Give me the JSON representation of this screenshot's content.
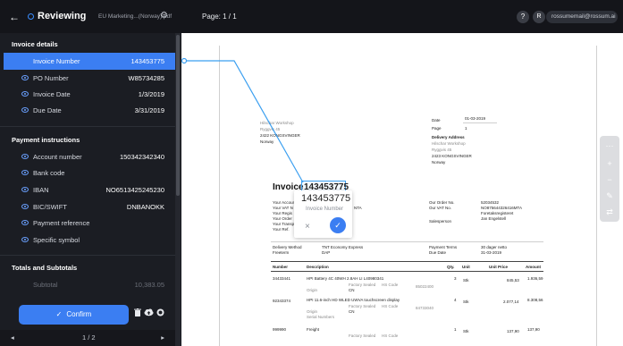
{
  "topbar": {
    "back_glyph": "←",
    "status": "Reviewing",
    "filename": "EU Marketing...(Norway).pdf",
    "gear_glyph": "⚙",
    "page": "Page: 1 / 1",
    "help": "?",
    "avatar": "R",
    "user_email": "rossumemail@rossum.ai"
  },
  "sidebar": {
    "invoice_details": {
      "title": "Invoice details",
      "rows": [
        {
          "label": "Invoice Number",
          "value": "143453775"
        },
        {
          "label": "PO Number",
          "value": "W85734285"
        },
        {
          "label": "Invoice Date",
          "value": "1/3/2019"
        },
        {
          "label": "Due Date",
          "value": "3/31/2019"
        }
      ]
    },
    "payment": {
      "title": "Payment instructions",
      "rows": [
        {
          "label": "Account number",
          "value": "150342342340"
        },
        {
          "label": "Bank code",
          "value": ""
        },
        {
          "label": "IBAN",
          "value": "NO6513425245230"
        },
        {
          "label": "BIC/SWIFT",
          "value": "DNBANOKK"
        },
        {
          "label": "Payment reference",
          "value": ""
        },
        {
          "label": "Specific symbol",
          "value": ""
        }
      ]
    },
    "totals": {
      "title": "Totals and Subtotals",
      "rows": [
        {
          "label": "Subtotal",
          "value": "10,383.05"
        }
      ]
    },
    "footer": {
      "confirm": "Confirm",
      "check_glyph": "✓",
      "pager": {
        "prev": "◂",
        "label": "1 / 2",
        "next": "▸"
      },
      "icons": [
        "trash-icon",
        "cloud-upload-icon",
        "block-icon"
      ]
    }
  },
  "document": {
    "from_name": "Hilschar Workshop",
    "from_street": "Ryggvis 45",
    "from_city": "2422 KONGSVINGER",
    "from_country": "Norway",
    "date_label": "Date",
    "date_value": "01-03-2019",
    "page_label": "Page",
    "page_value": "1",
    "delivery_label": "Delivery Address",
    "delivery_1": "Hilschar Workshop",
    "delivery_2": "Ryggvis 45",
    "delivery_3": "2423 KONGSVINGER",
    "delivery_4": "Norway",
    "invoice_word": "Invoice",
    "invoice_number": "143453775",
    "your_account": "Your Account",
    "your_vat": "Your VAT N",
    "your_register": "Your Regis",
    "your_order": "Your Order",
    "your_transport": "Your Transp",
    "your_ref": "Your Ref.",
    "vat_value": "NTA",
    "our_order_label": "Our Order No.",
    "our_order_value": "52034532",
    "our_vat_label": "Our VAT No.",
    "our_vat_value": "NO875644326416MTA",
    "register_value": "Foretaksregisteret",
    "salesperson_label": "Salesperson",
    "salesperson_value": "Jan Engelstell",
    "delivery_method_label": "Delivery Method",
    "delivery_method_value": "TNT Economy Express",
    "freeterm_label": "Freeterm",
    "freeterm_value": "DAP",
    "payment_terms_label": "Payment Terms",
    "payment_terms_value": "30 dager netto",
    "due_date_label": "Due Date",
    "due_date_value": "31-03-2019",
    "col_number": "Number",
    "col_description": "Description",
    "col_qty": "Qty.",
    "col_unit": "Unit",
    "col_unit_price": "Unit Price",
    "col_amount": "Amount",
    "lines": [
      {
        "number": "34433441",
        "description": "HPI Battery 4C 40WH 2.8AH LI L40980341",
        "qty": "3",
        "unit": "Stk",
        "price": "845,53",
        "amount": "1.936,59"
      },
      {
        "number": "92343374",
        "description": "HPI 11.6-inch HD WLED UWVA touchscreen display",
        "qty": "4",
        "unit": "Stk",
        "price": "2.077,14",
        "amount": "8.308,56"
      },
      {
        "number": "999990",
        "description": "Freight",
        "qty": "1",
        "unit": "Stk",
        "price": "137,90",
        "amount": "137,90"
      }
    ],
    "line_meta": {
      "origin": "Origin",
      "origin_value": "CN",
      "serial": "Serial Numbers",
      "factory_sealed": "Factory Sealed",
      "hs_code": "HS Code",
      "code_1": "85022400",
      "code_2": "84733040"
    }
  },
  "popup": {
    "value": "143453775",
    "label": "Invoice Number",
    "reject_glyph": "×",
    "accept_glyph": "✓"
  },
  "toolbar": {
    "icons": [
      {
        "name": "dots-icon",
        "glyph": "⋯"
      },
      {
        "name": "zoom-in-icon",
        "glyph": "+"
      },
      {
        "name": "zoom-out-icon",
        "glyph": "−"
      },
      {
        "name": "edit-icon",
        "glyph": "✎"
      },
      {
        "name": "translate-icon",
        "glyph": "⇄"
      }
    ]
  },
  "colors": {
    "accent": "#3b7ef2",
    "sidebar_bg": "#1b1d23",
    "topbar_bg": "#14151a",
    "link_line": "#3b9ff0"
  }
}
